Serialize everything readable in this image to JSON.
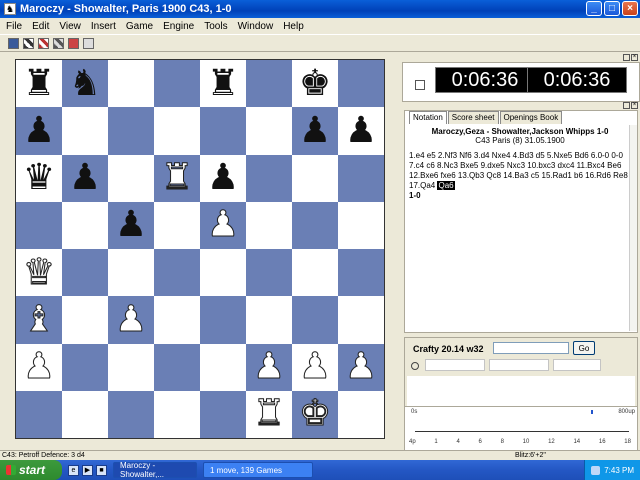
{
  "window": {
    "title": "Maroczy - Showalter, Paris 1900  C43, 1-0",
    "buttons": {
      "minimize": "_",
      "maximize": "□",
      "close": "×"
    }
  },
  "menu": [
    "File",
    "Edit",
    "View",
    "Insert",
    "Game",
    "Engine",
    "Tools",
    "Window",
    "Help"
  ],
  "toolbar": [
    "save-icon",
    "board-icon",
    "position-icon",
    "pieces-icon",
    "flip-icon",
    "print-icon"
  ],
  "board": {
    "light_color": "#ffffff",
    "dark_color": "#6a7fb5",
    "ranks": [
      [
        "r",
        "n",
        "",
        "",
        "r",
        "",
        "k",
        ""
      ],
      [
        "p",
        "",
        "",
        "",
        "",
        "",
        "p",
        "p"
      ],
      [
        "q",
        "p",
        "",
        "R",
        "p",
        "",
        "",
        ""
      ],
      [
        "",
        "",
        "p",
        "",
        "P",
        "",
        "",
        ""
      ],
      [
        "Q",
        "",
        "",
        "",
        "",
        "",
        "",
        ""
      ],
      [
        "B",
        "",
        "P",
        "",
        "",
        "",
        "",
        ""
      ],
      [
        "P",
        "",
        "",
        "",
        "",
        "P",
        "P",
        "P"
      ],
      [
        "",
        "",
        "",
        "",
        "",
        "R",
        "K",
        ""
      ]
    ]
  },
  "clocks": {
    "white": "0:06:36",
    "black": "0:06:36"
  },
  "notation": {
    "tabs": [
      "Notation",
      "Score sheet",
      "Openings Book"
    ],
    "active_tab": "Notation",
    "header": "Maroczy,Geza - Showalter,Jackson Whipps  1-0",
    "subheader": "C43 Paris (8) 31.05.1900",
    "moves": "1.e4  e5  2.Nf3  Nf6  3.d4  Nxe4  4.Bd3  d5  5.Nxe5  Bd6  6.0-0  0-0  7.c4  c6  8.Nc3  Bxe5  9.dxe5  Nxc3  10.bxc3  dxc4  11.Bxc4  Be6  12.Bxe6  fxe6  13.Qb3  Qc8  14.Ba3  c5  15.Rad1  b6  16.Rd6  Re8  17.Qa4 ",
    "last_move": "Qa6",
    "result": "1-0"
  },
  "engine": {
    "name": "Crafty 20.14 w32",
    "go_label": "Go"
  },
  "graph": {
    "top_label": "0s",
    "right_label": "800up",
    "left_label": "4p",
    "ticks": [
      "1",
      "4",
      "6",
      "8",
      "10",
      "12",
      "14",
      "16",
      "18"
    ]
  },
  "statusbar": {
    "left": "C43: Petroff Defence: 3 d4",
    "right": "Blitz:6'+2\""
  },
  "taskbar": {
    "start_label": "start",
    "tasks": [
      {
        "label": "Maroczy - Showalter,...",
        "active": true
      },
      {
        "label": "1 move,  139 Games",
        "active": false
      }
    ],
    "clock": "7:43 PM"
  }
}
